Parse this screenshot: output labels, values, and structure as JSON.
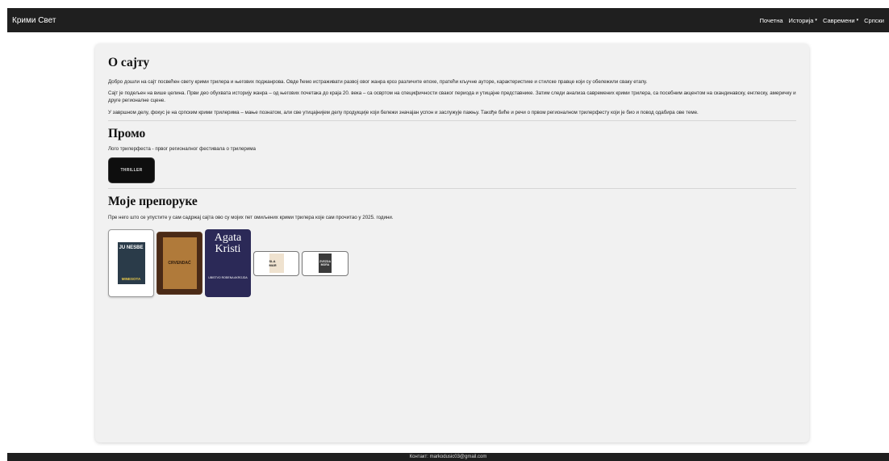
{
  "nav": {
    "brand": "Крими Свет",
    "items": [
      {
        "label": "Почетна",
        "dropdown": false
      },
      {
        "label": "Историја",
        "dropdown": true
      },
      {
        "label": "Савремени",
        "dropdown": true
      },
      {
        "label": "Српски",
        "dropdown": false
      }
    ],
    "caret": "▾"
  },
  "about": {
    "title": "О сајту",
    "paragraphs": [
      "Добро дошли на сајт посвећен свету крими трилера и његових поджанрова. Овде ћемо истраживати развој овог жанра кроз различите епохе, пратећи кључне ауторе, карактеристике и стилске правце који су обележили сваку етапу.",
      "Сајт је подељен на више целина. Први део обухвата историју жанра – од његових почетака до краја 20. века – са освртом на специфичности сваког периода и утицајне представнике. Затим следи анализа савремених крими трилера, са посебним акцентом на скандинавску, енглеску, америчку и друге регионалне сцене.",
      "У завршном делу, фокус је на српским крими трилерима – мање познатом, али све утицајнијем делу продукције који бележи значајан успон и заслужује пажњу. Такође биће и речи о првом регионалном трилерфесту који је био и повод одабира ове теме."
    ]
  },
  "promo": {
    "title": "Промо",
    "text": "Лого трилерфеста - првог регионалног фестивала о трилерима",
    "logo_text": "THRILLER"
  },
  "recommendations": {
    "title": "Моје препоруке",
    "text": "Пре него што се упустите у сам садржај сајта ово су мојих пет омиљених крими трилера које сам прочитао у 2025. години.",
    "books": [
      {
        "cover_title": "JU NESBE",
        "cover_subtitle": "MINESOTA"
      },
      {
        "cover_title": "CRVENDAĆ"
      },
      {
        "cover_title": "Agata Kristi",
        "cover_subtitle": "UBISTVO ROĐENA AKROJDA"
      },
      {
        "cover_title": "SLA MAR"
      },
      {
        "cover_title": "ZVEZDA MORA"
      }
    ]
  },
  "footer": {
    "text": "Контакт: markodusic03@gmail.com"
  }
}
